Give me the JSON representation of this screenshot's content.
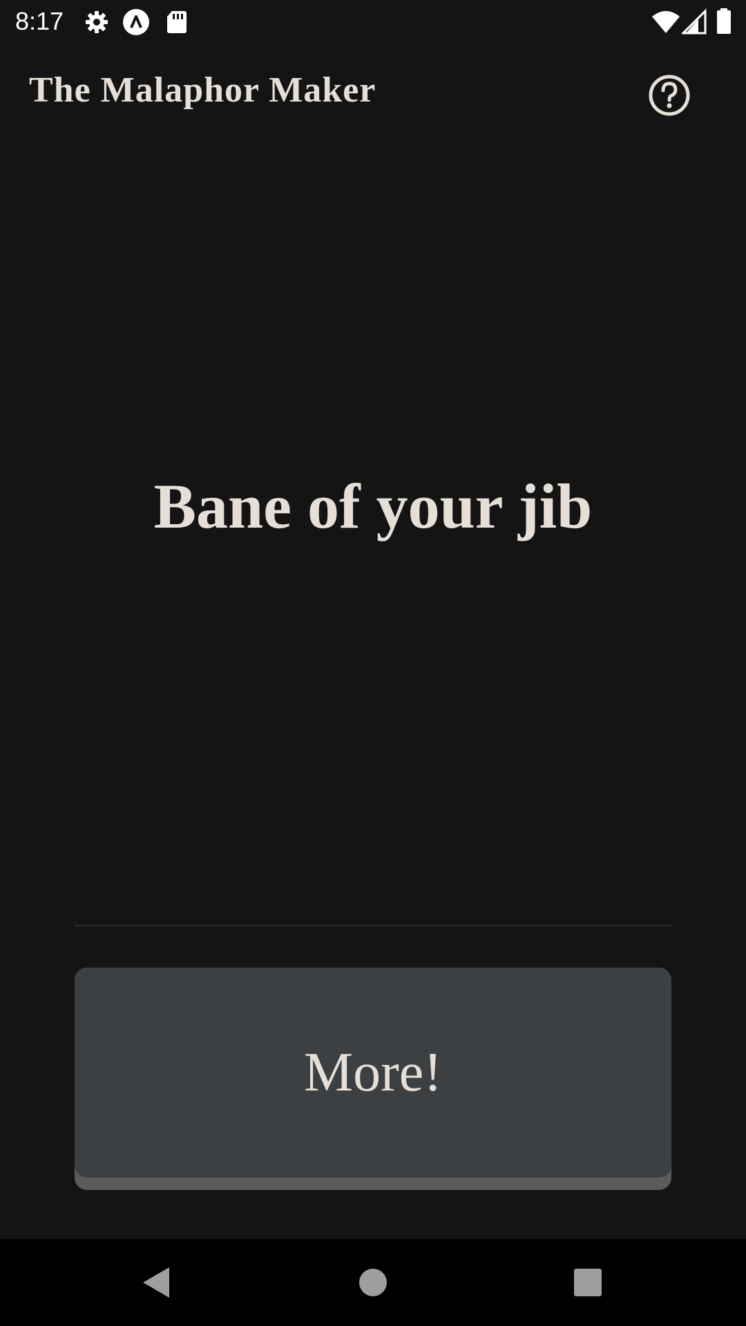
{
  "status_bar": {
    "time": "8:17",
    "left_icons": [
      "gear-icon",
      "app-notification-icon",
      "sd-card-icon"
    ],
    "right_icons": [
      "wifi-icon",
      "cell-signal-icon",
      "battery-icon"
    ]
  },
  "app_bar": {
    "title": "The Malaphor Maker",
    "help_icon": "help-circle-icon"
  },
  "main": {
    "phrase": "Bane of your jib",
    "more_button_label": "More!"
  },
  "nav_bar": {
    "icons": [
      "back-icon",
      "home-icon",
      "recents-icon"
    ]
  },
  "colors": {
    "background": "#141414",
    "text": "#e6dfd8",
    "button_face": "#3d4043",
    "button_shadow": "#5a5c5e"
  }
}
